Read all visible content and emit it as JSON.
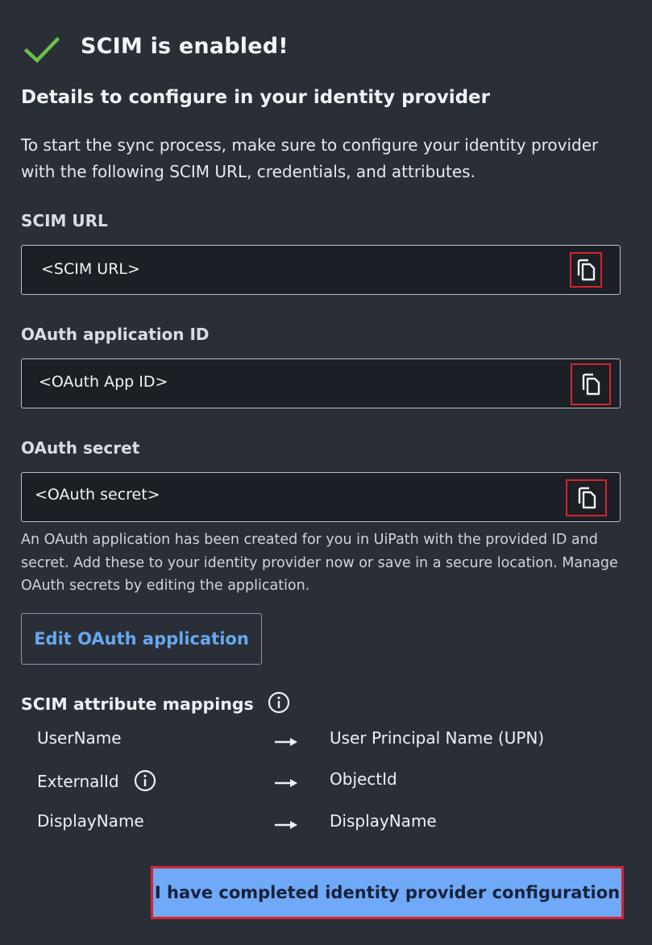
{
  "header": {
    "title": "SCIM is enabled!"
  },
  "section": {
    "heading": "Details to configure in your identity provider",
    "description": "To start the sync process, make sure to configure your identity provider with the following SCIM URL, credentials, and attributes."
  },
  "fields": {
    "scim_url": {
      "label": "SCIM URL",
      "value": "<SCIM URL>"
    },
    "oauth_app_id": {
      "label": "OAuth application ID",
      "value": "<OAuth App ID>"
    },
    "oauth_secret": {
      "label": "OAuth secret",
      "value": "<OAuth secret>"
    }
  },
  "note": "An OAuth application has been created for you in UiPath with the provided ID and secret. Add these to your identity provider now or save in a secure location. Manage OAuth secrets by editing the application.",
  "edit_button": "Edit OAuth application",
  "mappings": {
    "title": "SCIM attribute mappings",
    "rows": [
      {
        "left": "UserName",
        "right": "User Principal Name (UPN)",
        "info": false
      },
      {
        "left": "ExternalId",
        "right": "ObjectId",
        "info": true
      },
      {
        "left": "DisplayName",
        "right": "DisplayName",
        "info": false
      }
    ]
  },
  "primary_button": "I have completed identity provider configuration",
  "colors": {
    "background": "#2a2f37",
    "accent": "#6fa9f8",
    "success": "#6cc04a",
    "highlight": "#d6242e"
  },
  "icons": [
    "check-icon",
    "copy-icon",
    "info-icon",
    "arrow-right-icon"
  ]
}
